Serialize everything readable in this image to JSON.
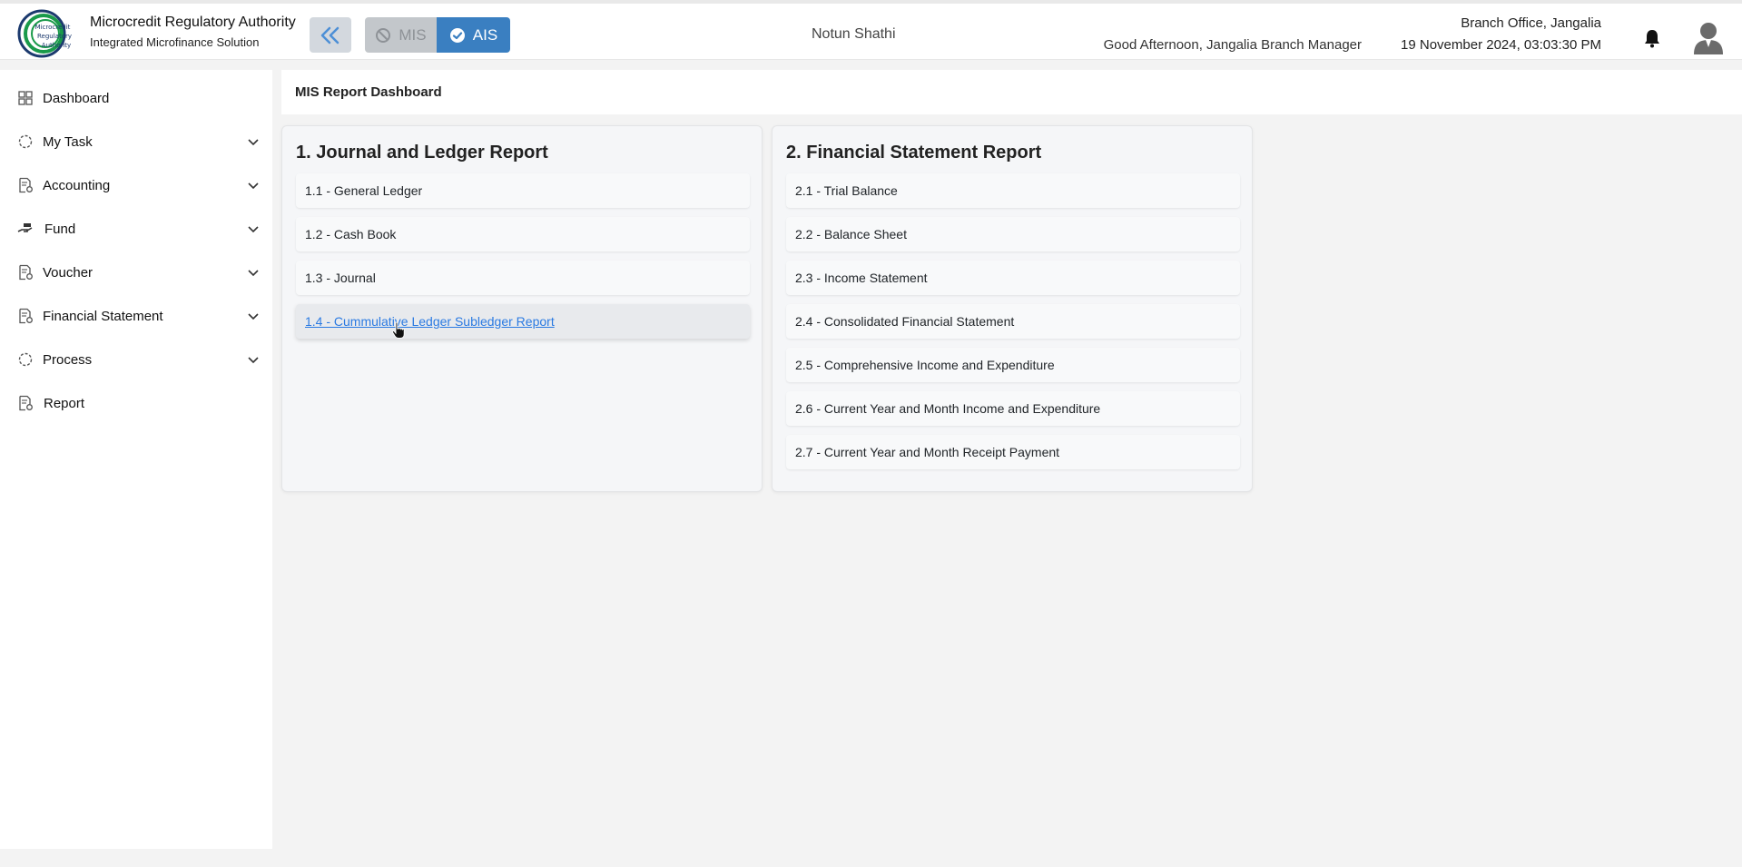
{
  "header": {
    "brand_title": "Microcredit Regulatory Authority",
    "brand_subtitle": "Integrated Microfinance Solution",
    "logo_text": [
      "Microcredit",
      "Regulatory",
      "Authority"
    ],
    "mis_label": "MIS",
    "ais_label": "AIS",
    "org_name": "Notun Shathi",
    "branch": "Branch Office, Jangalia",
    "greeting": "Good Afternoon, Jangalia Branch Manager",
    "datetime": "19 November 2024, 03:03:30 PM"
  },
  "sidebar": {
    "items": [
      {
        "label": "Dashboard",
        "icon": "grid-icon",
        "has_chevron": false
      },
      {
        "label": "My Task",
        "icon": "dotted-circle-icon",
        "has_chevron": true
      },
      {
        "label": "Accounting",
        "icon": "document-gear-icon",
        "has_chevron": true
      },
      {
        "label": "Fund",
        "icon": "hand-money-icon",
        "has_chevron": true
      },
      {
        "label": "Voucher",
        "icon": "document-gear-icon",
        "has_chevron": true
      },
      {
        "label": "Financial Statement",
        "icon": "document-gear-icon",
        "has_chevron": true
      },
      {
        "label": "Process",
        "icon": "dotted-circle-icon",
        "has_chevron": true
      },
      {
        "label": "Report",
        "icon": "document-gear-icon",
        "has_chevron": false
      }
    ]
  },
  "breadcrumb": {
    "title": "MIS Report Dashboard"
  },
  "cards": [
    {
      "title": "1. Journal and Ledger Report",
      "items": [
        "1.1 - General Ledger",
        "1.2 - Cash Book",
        "1.3 - Journal",
        "1.4 - Cummulative Ledger Subledger Report"
      ]
    },
    {
      "title": "2. Financial Statement Report",
      "items": [
        "2.1 - Trial Balance",
        "2.2 - Balance Sheet",
        "2.3 - Income Statement",
        "2.4 - Consolidated Financial Statement",
        "2.5 - Comprehensive Income and Expenditure",
        "2.6 - Current Year and Month Income and Expenditure",
        "2.7 - Current Year and Month Receipt Payment"
      ]
    }
  ],
  "colors": {
    "accent": "#3a7fc1",
    "link": "#2a7ae2",
    "logo_green": "#1a9a4a",
    "logo_navy": "#1c3a6e"
  }
}
